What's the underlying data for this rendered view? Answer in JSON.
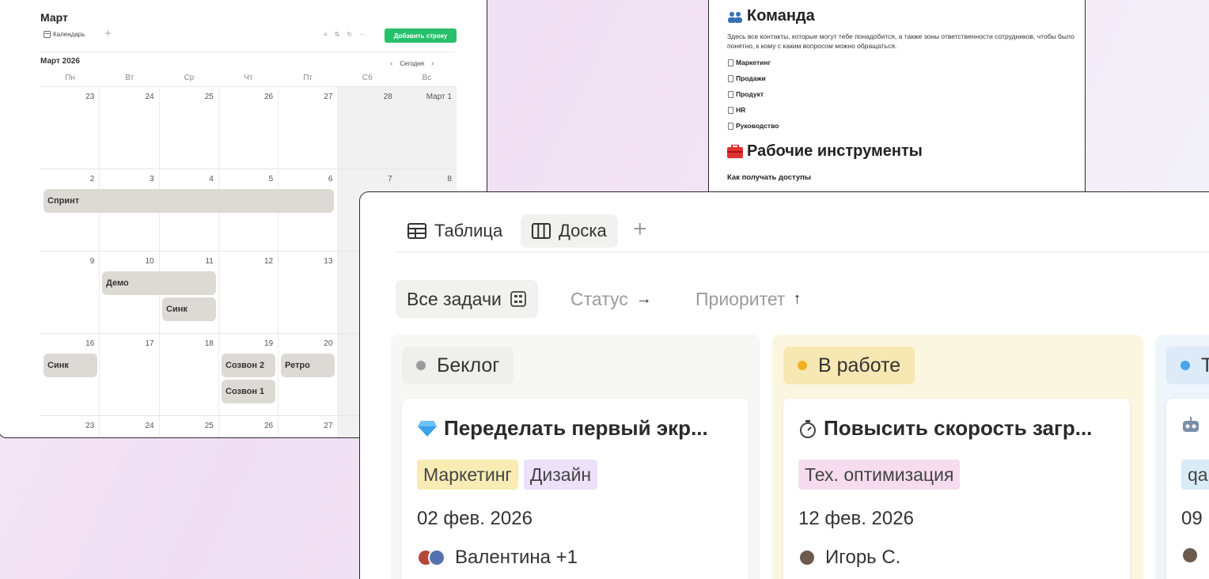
{
  "calendar": {
    "title": "Март",
    "view_tab": "Календарь",
    "add_row": "Добавить строку",
    "month_label": "Март 2026",
    "today": "Сегодня",
    "weekdays": [
      "Пн",
      "Вт",
      "Ср",
      "Чт",
      "Пт",
      "Сб",
      "Вс"
    ],
    "weeks": [
      [
        "23",
        "24",
        "25",
        "26",
        "27",
        "28",
        "Март 1"
      ],
      [
        "2",
        "3",
        "4",
        "5",
        "6",
        "7",
        "8"
      ],
      [
        "9",
        "10",
        "11",
        "12",
        "13",
        "",
        ""
      ],
      [
        "16",
        "17",
        "18",
        "19",
        "20",
        "",
        ""
      ],
      [
        "23",
        "24",
        "25",
        "26",
        "27",
        "",
        ""
      ]
    ],
    "events": {
      "sprint": "Спринт",
      "demo": "Демо",
      "sync1": "Синк",
      "sync2": "Синк",
      "call2": "Созвон 2",
      "call1": "Созвон 1",
      "retro": "Ретро"
    }
  },
  "doc": {
    "team_heading": "Команда",
    "team_desc": "Здесь все контакты, которые могут тебе понадобится, а также зоны ответственности сотрудников, чтобы было понятно, к кому с каким вопросом можно обращаться.",
    "links": [
      "Маркетинг",
      "Продажи",
      "Продукт",
      "HR",
      "Руководство"
    ],
    "tools_heading": "Рабочие инструменты",
    "access_label": "Как получать доступы"
  },
  "board": {
    "tab_table": "Таблица",
    "tab_board": "Доска",
    "filter_all": "Все задачи",
    "filter_status": "Статус",
    "filter_priority": "Приоритет",
    "columns": [
      {
        "name": "Беклог",
        "dot_color": "#9b9b9b",
        "card": {
          "title": "Переделать первый экр...",
          "tags": [
            "Маркетинг",
            "Дизайн"
          ],
          "date": "02 фев. 2026",
          "assignee": "Валентина +1"
        }
      },
      {
        "name": "В работе",
        "dot_color": "#f2b01e",
        "card": {
          "title": "Повысить скорость загр...",
          "tags": [
            "Тех. оптимизация"
          ],
          "date": "12 фев. 2026",
          "assignee": "Игорь С."
        }
      },
      {
        "name": "Т",
        "dot_color": "#4aa6e8",
        "card": {
          "title": "",
          "tags": [
            "qa"
          ],
          "date": "09",
          "assignee": ""
        }
      }
    ]
  },
  "colors": {
    "accent_green": "#27c06a",
    "tag_marketing": "#f8ecb4",
    "tag_design": "#ece0fb",
    "tag_tech": "#f6dcee",
    "tag_qa": "#d8ecf8"
  }
}
